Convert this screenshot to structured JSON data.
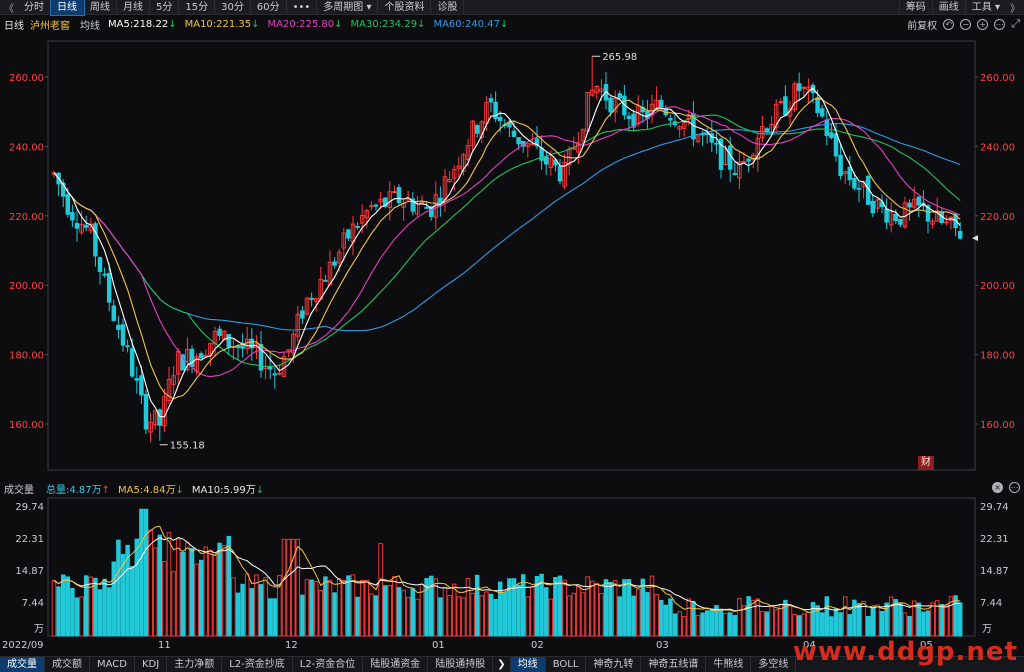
{
  "toolbar": {
    "back": "《",
    "tabs": [
      {
        "label": "分时"
      },
      {
        "label": "日线",
        "active": true
      },
      {
        "label": "周线"
      },
      {
        "label": "月线"
      },
      {
        "label": "5分"
      },
      {
        "label": "15分"
      },
      {
        "label": "30分"
      },
      {
        "label": "60分"
      },
      {
        "label": "•••"
      },
      {
        "label": "多周期图 ▾"
      },
      {
        "label": "个股资料"
      },
      {
        "label": "诊股"
      }
    ],
    "right": [
      "筹码",
      "画线",
      "工具 ▾"
    ],
    "forward": "》"
  },
  "info": {
    "period": "日线",
    "stock_name": "泸州老窖",
    "avg_label": "均线",
    "ma": [
      {
        "label": "MA5:218.22",
        "color": "#ffffff",
        "trend": "down"
      },
      {
        "label": "MA10:221.35",
        "color": "#f0c34a",
        "trend": "down"
      },
      {
        "label": "MA20:225.80",
        "color": "#e040c0",
        "trend": "down"
      },
      {
        "label": "MA30:234.29",
        "color": "#20c060",
        "trend": "down"
      },
      {
        "label": "MA60:240.47",
        "color": "#2f9be8",
        "trend": "down"
      }
    ],
    "adjust": "前复权",
    "arrow_down": "↓",
    "arrow_up": "↑"
  },
  "price_axis": [
    "260.00",
    "240.00",
    "220.00",
    "200.00",
    "180.00",
    "160.00"
  ],
  "annotations": {
    "high": "265.98",
    "low": "155.18"
  },
  "cai_badge": "财",
  "volume": {
    "title": "成交量",
    "total": "总量:4.87万",
    "ma5": "MA5:4.84万",
    "ma10": "MA10:5.99万",
    "axis": [
      "29.74",
      "22.31",
      "14.87",
      "7.44"
    ],
    "unit": "万"
  },
  "dates": [
    "2022/09",
    "11",
    "12",
    "01",
    "02",
    "03",
    "04",
    "05"
  ],
  "bottom_tabs": [
    {
      "label": "成交量",
      "active": true
    },
    {
      "label": "成交额"
    },
    {
      "label": "MACD"
    },
    {
      "label": "KDJ"
    },
    {
      "label": "主力净额"
    },
    {
      "label": "L2-资金抄底"
    },
    {
      "label": "L2-资金合位"
    },
    {
      "label": "陆股通资金"
    },
    {
      "label": "陆股通持股"
    },
    {
      "label": "❯",
      "sep": true
    },
    {
      "label": "均线",
      "active": true
    },
    {
      "label": "BOLL"
    },
    {
      "label": "神奇九转"
    },
    {
      "label": "神奇五线谱"
    },
    {
      "label": "牛熊线"
    },
    {
      "label": "多空线"
    }
  ],
  "watermark": "www.ddgp.net",
  "colors": {
    "up": "#ff3b3b",
    "down": "#20c8d8",
    "ma5": "#ffffff",
    "ma10": "#f0c34a",
    "ma20": "#e040c0",
    "ma30": "#20c060",
    "ma60": "#2f9be8",
    "axis_text": "#ff4040"
  },
  "chart_data": {
    "type": "candlestick",
    "anchor_points": [
      {
        "date": "2022/09",
        "close": 232
      },
      {
        "date": "11",
        "close": 162
      },
      {
        "date": "12",
        "close": 178
      },
      {
        "date": "01",
        "close": 222
      },
      {
        "date": "02",
        "close": 240
      },
      {
        "date": "03",
        "close": 252
      },
      {
        "date": "04",
        "close": 242
      },
      {
        "date": "05",
        "close": 215
      }
    ],
    "high": 265.98,
    "low": 155.18,
    "ylim": [
      150,
      270
    ],
    "ma_last": {
      "MA5": 218.22,
      "MA10": 221.35,
      "MA20": 225.8,
      "MA30": 234.29,
      "MA60": 240.47
    },
    "volume_ylim": [
      0,
      29.74
    ],
    "volume_unit": "万"
  }
}
